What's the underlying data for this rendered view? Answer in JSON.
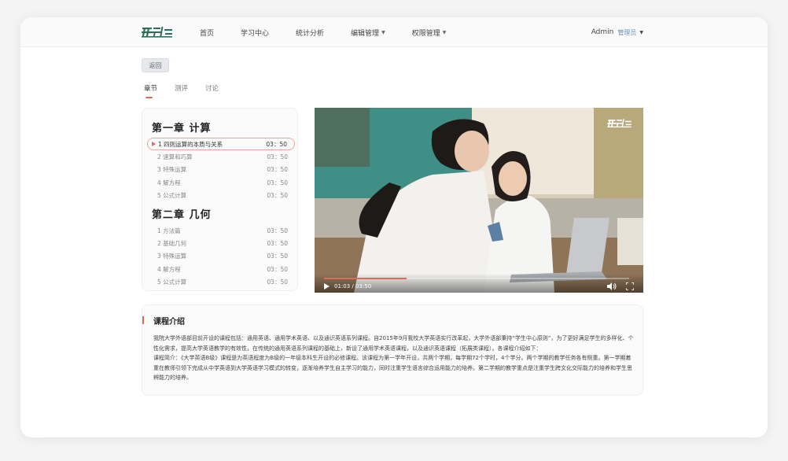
{
  "header": {
    "logo_text": "开元程",
    "nav": [
      {
        "label": "首页",
        "has_dropdown": false
      },
      {
        "label": "学习中心",
        "has_dropdown": false
      },
      {
        "label": "统计分析",
        "has_dropdown": false
      },
      {
        "label": "编辑管理",
        "has_dropdown": true
      },
      {
        "label": "权限管理",
        "has_dropdown": true
      }
    ],
    "user": {
      "name": "Admin",
      "role": "管理员"
    }
  },
  "back_label": "返回",
  "tabs": [
    {
      "label": "章节",
      "active": true
    },
    {
      "label": "测评",
      "active": false
    },
    {
      "label": "讨论",
      "active": false
    }
  ],
  "chapters": [
    {
      "title": "第一章  计算",
      "lessons": [
        {
          "name": "1 四则运算的本质与关系",
          "time": "03：50",
          "active": true
        },
        {
          "name": "2 速算和巧算",
          "time": "03：50",
          "active": false
        },
        {
          "name": "3 特殊运算",
          "time": "03：50",
          "active": false
        },
        {
          "name": "4 解方程",
          "time": "03：50",
          "active": false
        },
        {
          "name": "5 公式计算",
          "time": "03：50",
          "active": false
        }
      ]
    },
    {
      "title": "第二章  几何",
      "lessons": [
        {
          "name": "1 方法篇",
          "time": "03：50",
          "active": false
        },
        {
          "name": "2 基础几何",
          "time": "03：50",
          "active": false
        },
        {
          "name": "3 特殊运算",
          "time": "03：50",
          "active": false
        },
        {
          "name": "4 解方程",
          "time": "03：50",
          "active": false
        },
        {
          "name": "5 公式计算",
          "time": "03：50",
          "active": false
        }
      ]
    }
  ],
  "video": {
    "logo_text": "开元程",
    "time_display": "01:03 / 03:50",
    "progress": 0.27
  },
  "intro": {
    "title": "课程介绍",
    "paragraphs": [
      "我院大学外语部目前开设的课程包括：通用英语、通用学术英语、以及通识英语系列课程。自2015年9月我校大学英语实行改革起，大学外语部秉持“学生中心原则”，为了更好满足学生的多样化、个性化需求，提高大学英语教学的有效性，在传统的通用英语系列课程的基础上，新设了通用学术英语课程，以及通识英语课程（拓展类课程）。各课程介绍如下：",
      "课程简介：《大学英语B级》课程是为英语程度为B级的一年级本科生开设的必修课程。该课程为第一学年开设，共两个学期，每学期72个学时，4个学分。两个学期的教学任务各有侧重。第一学期着重在教师引领下完成从中学英语到大学英语学习模式的转变，逐渐培养学生自主学习的能力，同时注重学生语言综合运用能力的培养。第二学期的教学重点是注重学生跨文化交际能力的培养和学生思辨能力的培养。"
    ]
  },
  "colors": {
    "accent": "#e06a5a",
    "logo": "#2f6e57",
    "role": "#6b8fb5"
  }
}
